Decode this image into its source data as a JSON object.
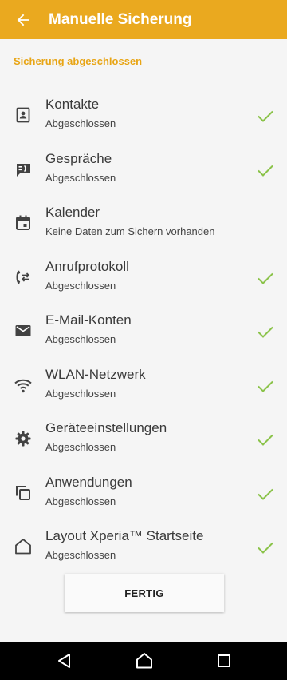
{
  "header": {
    "title": "Manuelle Sicherung",
    "back_icon": "arrow-left-icon"
  },
  "section": {
    "title": "Sicherung abgeschlossen"
  },
  "items": [
    {
      "label": "Kontakte",
      "status": "Abgeschlossen",
      "icon": "contact-icon",
      "done": true
    },
    {
      "label": "Gespräche",
      "status": "Abgeschlossen",
      "icon": "message-icon",
      "done": true
    },
    {
      "label": "Kalender",
      "status": "Keine Daten zum Sichern vorhanden",
      "icon": "calendar-icon",
      "done": false
    },
    {
      "label": "Anrufprotokoll",
      "status": "Abgeschlossen",
      "icon": "call-log-icon",
      "done": true
    },
    {
      "label": "E-Mail-Konten",
      "status": "Abgeschlossen",
      "icon": "email-icon",
      "done": true
    },
    {
      "label": "WLAN-Netzwerk",
      "status": "Abgeschlossen",
      "icon": "wifi-icon",
      "done": true
    },
    {
      "label": "Geräteeinstellungen",
      "status": "Abgeschlossen",
      "icon": "settings-gear-icon",
      "done": true
    },
    {
      "label": "Anwendungen",
      "status": "Abgeschlossen",
      "icon": "apps-icon",
      "done": true
    },
    {
      "label": "Layout Xperia™ Startseite",
      "status": "Abgeschlossen",
      "icon": "home-icon",
      "done": true
    }
  ],
  "done_button": {
    "label": "FERTIG"
  },
  "colors": {
    "accent": "#eaa91f",
    "check": "#8bc34a",
    "icon": "#424242"
  }
}
